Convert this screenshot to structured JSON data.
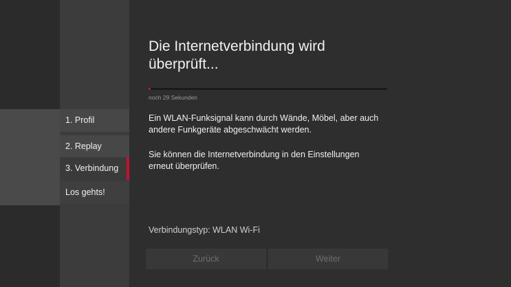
{
  "sidebar": {
    "items": [
      {
        "label": "1. Profil"
      },
      {
        "label": "2. Replay"
      },
      {
        "label": "3. Verbindung",
        "active": true
      },
      {
        "label": "Los gehts!"
      }
    ]
  },
  "main": {
    "title": "Die Internetverbindung wird überprüft...",
    "progress": {
      "fraction": 0.01,
      "countdown_text": "noch 29 Sekunden"
    },
    "paragraph_1": "Ein WLAN-Funksignal kann durch Wände, Möbel, aber auch andere Funkgeräte abgeschwächt werden.",
    "paragraph_2": "Sie können die Internetverbindung in den Einstellungen erneut überprüfen.",
    "connection_type": "Verbindungstyp: WLAN Wi-Fi",
    "buttons": {
      "back": "Zurück",
      "next": "Weiter"
    }
  },
  "colors": {
    "accent": "#c8102e",
    "background": "#2e2e2e"
  }
}
